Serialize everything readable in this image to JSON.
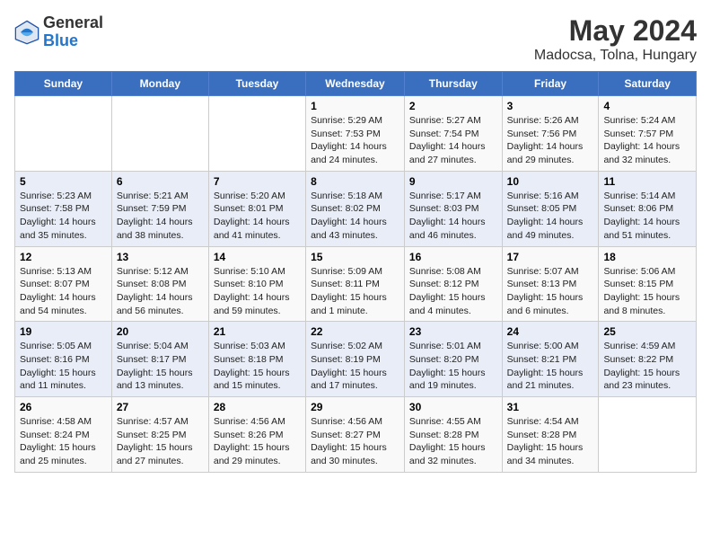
{
  "header": {
    "logo_line1": "General",
    "logo_line2": "Blue",
    "title": "May 2024",
    "subtitle": "Madocsa, Tolna, Hungary"
  },
  "weekdays": [
    "Sunday",
    "Monday",
    "Tuesday",
    "Wednesday",
    "Thursday",
    "Friday",
    "Saturday"
  ],
  "weeks": [
    [
      {
        "day": "",
        "info": ""
      },
      {
        "day": "",
        "info": ""
      },
      {
        "day": "",
        "info": ""
      },
      {
        "day": "1",
        "info": "Sunrise: 5:29 AM\nSunset: 7:53 PM\nDaylight: 14 hours\nand 24 minutes."
      },
      {
        "day": "2",
        "info": "Sunrise: 5:27 AM\nSunset: 7:54 PM\nDaylight: 14 hours\nand 27 minutes."
      },
      {
        "day": "3",
        "info": "Sunrise: 5:26 AM\nSunset: 7:56 PM\nDaylight: 14 hours\nand 29 minutes."
      },
      {
        "day": "4",
        "info": "Sunrise: 5:24 AM\nSunset: 7:57 PM\nDaylight: 14 hours\nand 32 minutes."
      }
    ],
    [
      {
        "day": "5",
        "info": "Sunrise: 5:23 AM\nSunset: 7:58 PM\nDaylight: 14 hours\nand 35 minutes."
      },
      {
        "day": "6",
        "info": "Sunrise: 5:21 AM\nSunset: 7:59 PM\nDaylight: 14 hours\nand 38 minutes."
      },
      {
        "day": "7",
        "info": "Sunrise: 5:20 AM\nSunset: 8:01 PM\nDaylight: 14 hours\nand 41 minutes."
      },
      {
        "day": "8",
        "info": "Sunrise: 5:18 AM\nSunset: 8:02 PM\nDaylight: 14 hours\nand 43 minutes."
      },
      {
        "day": "9",
        "info": "Sunrise: 5:17 AM\nSunset: 8:03 PM\nDaylight: 14 hours\nand 46 minutes."
      },
      {
        "day": "10",
        "info": "Sunrise: 5:16 AM\nSunset: 8:05 PM\nDaylight: 14 hours\nand 49 minutes."
      },
      {
        "day": "11",
        "info": "Sunrise: 5:14 AM\nSunset: 8:06 PM\nDaylight: 14 hours\nand 51 minutes."
      }
    ],
    [
      {
        "day": "12",
        "info": "Sunrise: 5:13 AM\nSunset: 8:07 PM\nDaylight: 14 hours\nand 54 minutes."
      },
      {
        "day": "13",
        "info": "Sunrise: 5:12 AM\nSunset: 8:08 PM\nDaylight: 14 hours\nand 56 minutes."
      },
      {
        "day": "14",
        "info": "Sunrise: 5:10 AM\nSunset: 8:10 PM\nDaylight: 14 hours\nand 59 minutes."
      },
      {
        "day": "15",
        "info": "Sunrise: 5:09 AM\nSunset: 8:11 PM\nDaylight: 15 hours\nand 1 minute."
      },
      {
        "day": "16",
        "info": "Sunrise: 5:08 AM\nSunset: 8:12 PM\nDaylight: 15 hours\nand 4 minutes."
      },
      {
        "day": "17",
        "info": "Sunrise: 5:07 AM\nSunset: 8:13 PM\nDaylight: 15 hours\nand 6 minutes."
      },
      {
        "day": "18",
        "info": "Sunrise: 5:06 AM\nSunset: 8:15 PM\nDaylight: 15 hours\nand 8 minutes."
      }
    ],
    [
      {
        "day": "19",
        "info": "Sunrise: 5:05 AM\nSunset: 8:16 PM\nDaylight: 15 hours\nand 11 minutes."
      },
      {
        "day": "20",
        "info": "Sunrise: 5:04 AM\nSunset: 8:17 PM\nDaylight: 15 hours\nand 13 minutes."
      },
      {
        "day": "21",
        "info": "Sunrise: 5:03 AM\nSunset: 8:18 PM\nDaylight: 15 hours\nand 15 minutes."
      },
      {
        "day": "22",
        "info": "Sunrise: 5:02 AM\nSunset: 8:19 PM\nDaylight: 15 hours\nand 17 minutes."
      },
      {
        "day": "23",
        "info": "Sunrise: 5:01 AM\nSunset: 8:20 PM\nDaylight: 15 hours\nand 19 minutes."
      },
      {
        "day": "24",
        "info": "Sunrise: 5:00 AM\nSunset: 8:21 PM\nDaylight: 15 hours\nand 21 minutes."
      },
      {
        "day": "25",
        "info": "Sunrise: 4:59 AM\nSunset: 8:22 PM\nDaylight: 15 hours\nand 23 minutes."
      }
    ],
    [
      {
        "day": "26",
        "info": "Sunrise: 4:58 AM\nSunset: 8:24 PM\nDaylight: 15 hours\nand 25 minutes."
      },
      {
        "day": "27",
        "info": "Sunrise: 4:57 AM\nSunset: 8:25 PM\nDaylight: 15 hours\nand 27 minutes."
      },
      {
        "day": "28",
        "info": "Sunrise: 4:56 AM\nSunset: 8:26 PM\nDaylight: 15 hours\nand 29 minutes."
      },
      {
        "day": "29",
        "info": "Sunrise: 4:56 AM\nSunset: 8:27 PM\nDaylight: 15 hours\nand 30 minutes."
      },
      {
        "day": "30",
        "info": "Sunrise: 4:55 AM\nSunset: 8:28 PM\nDaylight: 15 hours\nand 32 minutes."
      },
      {
        "day": "31",
        "info": "Sunrise: 4:54 AM\nSunset: 8:28 PM\nDaylight: 15 hours\nand 34 minutes."
      },
      {
        "day": "",
        "info": ""
      }
    ]
  ]
}
